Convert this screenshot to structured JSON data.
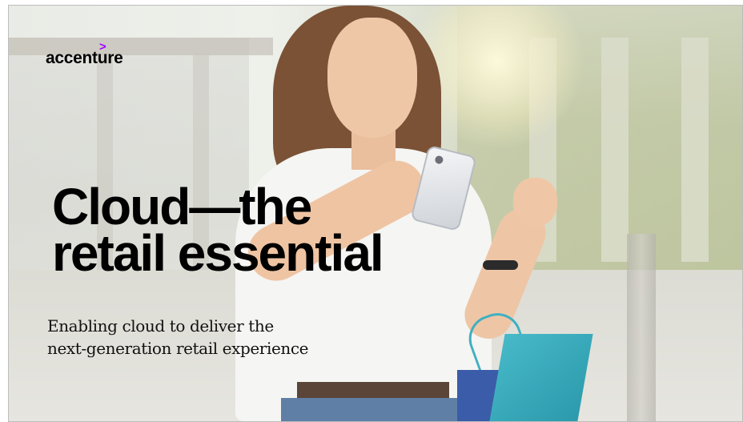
{
  "brand": {
    "logo_text": "accenture",
    "logo_mark": ">",
    "accent_color": "#a100ff"
  },
  "headline": {
    "line1": "Cloud—the",
    "line2": "retail essential"
  },
  "subtitle": {
    "line1": "Enabling cloud to deliver the",
    "line2": "next-generation retail experience"
  },
  "image": {
    "icon": "woman-shopping-with-phone-photo"
  }
}
